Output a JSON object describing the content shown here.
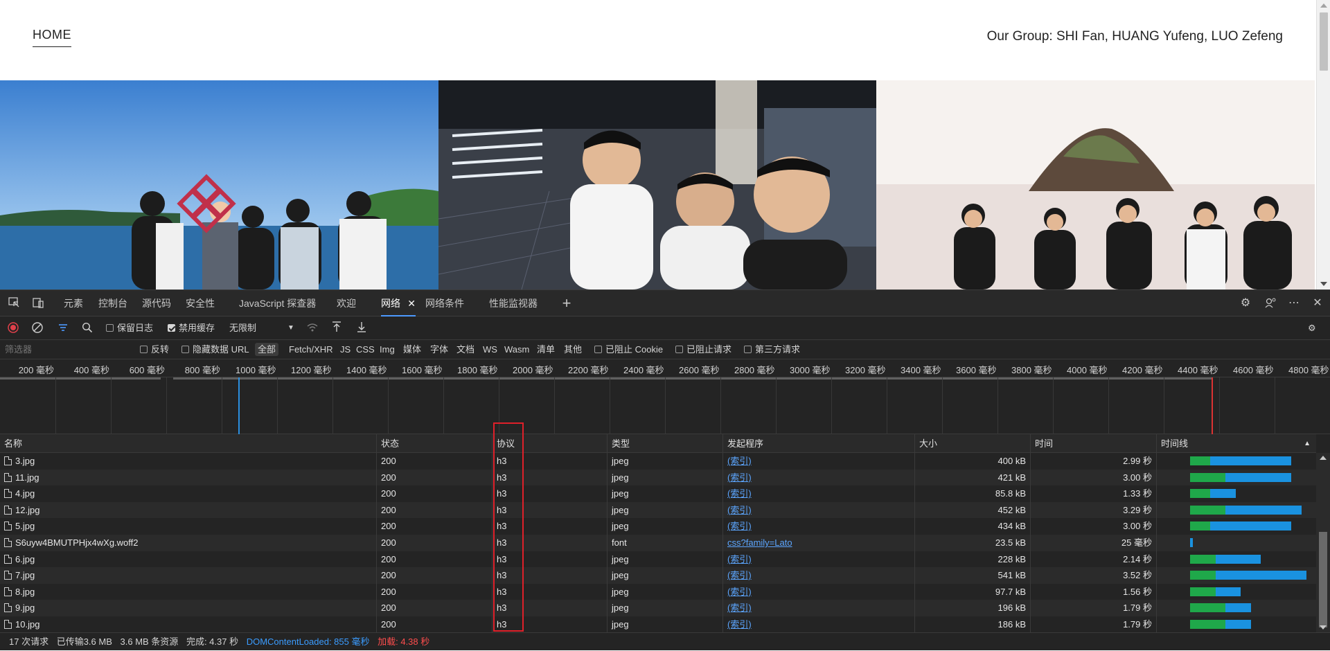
{
  "page": {
    "nav_home": "HOME",
    "group_text": "Our Group: SHI Fan, HUANG Yufeng, LUO Zefeng"
  },
  "devtools": {
    "tabs": [
      "元素",
      "控制台",
      "源代码",
      "安全性",
      "JavaScript 探查器",
      "欢迎",
      "网络",
      "网络条件",
      "性能监视器"
    ],
    "active_tab": "网络",
    "toolbar": {
      "preserve_log": "保留日志",
      "disable_cache": "禁用缓存",
      "throttle": "无限制"
    },
    "filterbar": {
      "filter_placeholder": "筛选器",
      "invert": "反转",
      "hide_data_url": "隐藏数据 URL",
      "all": "全部",
      "types": [
        "Fetch/XHR",
        "JS",
        "CSS",
        "Img",
        "媒体",
        "字体",
        "文档",
        "WS",
        "Wasm",
        "清单",
        "其他"
      ],
      "blocked_cookies": "已阻止 Cookie",
      "blocked_requests": "已阻止请求",
      "third_party": "第三方请求"
    },
    "timeline_ticks": [
      "200  毫秒",
      "400  毫秒",
      "600  毫秒",
      "800  毫秒",
      "1000  毫秒",
      "1200  毫秒",
      "1400  毫秒",
      "1600  毫秒",
      "1800  毫秒",
      "2000  毫秒",
      "2200  毫秒",
      "2400  毫秒",
      "2600  毫秒",
      "2800  毫秒",
      "3000  毫秒",
      "3200  毫秒",
      "3400  毫秒",
      "3600  毫秒",
      "3800  毫秒",
      "4000  毫秒",
      "4200  毫秒",
      "4400  毫秒",
      "4600  毫秒",
      "4800  毫秒"
    ],
    "columns": [
      "名称",
      "状态",
      "协议",
      "类型",
      "发起程序",
      "大小",
      "时间",
      "时间线"
    ],
    "rows": [
      {
        "name": "3.jpg",
        "status": "200",
        "protocol": "h3",
        "type": "jpeg",
        "initiator": "(索引)",
        "size": "400 kB",
        "time": "2.99 秒",
        "wait": 0.04,
        "total": 0.2
      },
      {
        "name": "11.jpg",
        "status": "200",
        "protocol": "h3",
        "type": "jpeg",
        "initiator": "(索引)",
        "size": "421 kB",
        "time": "3.00 秒",
        "wait": 0.07,
        "total": 0.2
      },
      {
        "name": "4.jpg",
        "status": "200",
        "protocol": "h3",
        "type": "jpeg",
        "initiator": "(索引)",
        "size": "85.8 kB",
        "time": "1.33 秒",
        "wait": 0.04,
        "total": 0.09
      },
      {
        "name": "12.jpg",
        "status": "200",
        "protocol": "h3",
        "type": "jpeg",
        "initiator": "(索引)",
        "size": "452 kB",
        "time": "3.29 秒",
        "wait": 0.07,
        "total": 0.22
      },
      {
        "name": "5.jpg",
        "status": "200",
        "protocol": "h3",
        "type": "jpeg",
        "initiator": "(索引)",
        "size": "434 kB",
        "time": "3.00 秒",
        "wait": 0.04,
        "total": 0.2
      },
      {
        "name": "S6uyw4BMUTPHjx4wXg.woff2",
        "status": "200",
        "protocol": "h3",
        "type": "font",
        "initiator": "css?family=Lato",
        "size": "23.5 kB",
        "time": "25  毫秒",
        "wait": 0.0,
        "total": 0.004
      },
      {
        "name": "6.jpg",
        "status": "200",
        "protocol": "h3",
        "type": "jpeg",
        "initiator": "(索引)",
        "size": "228 kB",
        "time": "2.14 秒",
        "wait": 0.05,
        "total": 0.14
      },
      {
        "name": "7.jpg",
        "status": "200",
        "protocol": "h3",
        "type": "jpeg",
        "initiator": "(索引)",
        "size": "541 kB",
        "time": "3.52 秒",
        "wait": 0.05,
        "total": 0.23
      },
      {
        "name": "8.jpg",
        "status": "200",
        "protocol": "h3",
        "type": "jpeg",
        "initiator": "(索引)",
        "size": "97.7 kB",
        "time": "1.56 秒",
        "wait": 0.05,
        "total": 0.1
      },
      {
        "name": "9.jpg",
        "status": "200",
        "protocol": "h3",
        "type": "jpeg",
        "initiator": "(索引)",
        "size": "196 kB",
        "time": "1.79 秒",
        "wait": 0.07,
        "total": 0.12
      },
      {
        "name": "10.jpg",
        "status": "200",
        "protocol": "h3",
        "type": "jpeg",
        "initiator": "(索引)",
        "size": "186 kB",
        "time": "1.79 秒",
        "wait": 0.07,
        "total": 0.12
      }
    ],
    "status": {
      "requests": "17 次请求",
      "transferred": "已传输3.6 MB",
      "resources": "3.6 MB 条资源",
      "finish": "完成: 4.37 秒",
      "dom_loaded": "DOMContentLoaded: 855  毫秒",
      "load": "加载: 4.38 秒"
    },
    "colors": {
      "accent": "#4c9aff",
      "dom_loaded": "#3b9cff",
      "load": "#ff4d4d",
      "waiting": "#1fa84a",
      "download": "#1a92e0",
      "highlight_box": "#e0202a"
    }
  }
}
